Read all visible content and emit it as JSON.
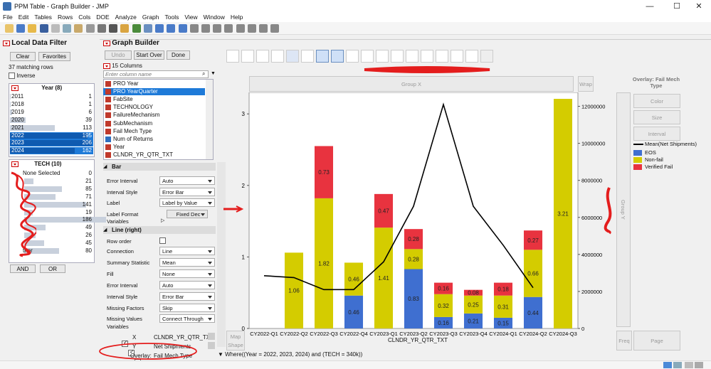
{
  "window": {
    "title": "PPM Table - Graph Builder - JMP",
    "min": "—",
    "max": "☐",
    "close": "✕"
  },
  "menu": [
    "File",
    "Edit",
    "Tables",
    "Rows",
    "Cols",
    "DOE",
    "Analyze",
    "Graph",
    "Tools",
    "View",
    "Window",
    "Help"
  ],
  "filter": {
    "title": "Local Data Filter",
    "clear": "Clear",
    "favorites": "Favorites",
    "matching": "37 matching rows",
    "inverse": "Inverse",
    "year_head": "Year (8)",
    "years": [
      {
        "label": "2011",
        "count": "1",
        "frac": 0.005,
        "sel": false
      },
      {
        "label": "2018",
        "count": "1",
        "frac": 0.005,
        "sel": false
      },
      {
        "label": "2019",
        "count": "6",
        "frac": 0.03,
        "sel": false
      },
      {
        "label": "2020",
        "count": "39",
        "frac": 0.19,
        "sel": false
      },
      {
        "label": "2021",
        "count": "113",
        "frac": 0.55,
        "sel": false
      },
      {
        "label": "2022",
        "count": "195",
        "frac": 0.95,
        "sel": true
      },
      {
        "label": "2023",
        "count": "206",
        "frac": 1.0,
        "sel": true
      },
      {
        "label": "2024",
        "count": "162",
        "frac": 0.79,
        "sel": true
      }
    ],
    "tech_head": "TECH (10)",
    "tech": [
      {
        "label": "None Selected",
        "count": "0",
        "frac": 0
      },
      {
        "label": "",
        "count": "21",
        "frac": 0.11
      },
      {
        "label": "",
        "count": "85",
        "frac": 0.46
      },
      {
        "label": "",
        "count": "71",
        "frac": 0.38
      },
      {
        "label": "",
        "count": "141",
        "frac": 0.76
      },
      {
        "label": "",
        "count": "19",
        "frac": 0.1
      },
      {
        "label": "",
        "count": "186",
        "frac": 1.0
      },
      {
        "label": "",
        "count": "49",
        "frac": 0.26
      },
      {
        "label": "",
        "count": "26",
        "frac": 0.14
      },
      {
        "label": "",
        "count": "45",
        "frac": 0.24
      },
      {
        "label": "ther",
        "count": "80",
        "frac": 0.43
      }
    ],
    "and": "AND",
    "or": "OR"
  },
  "builder": {
    "title": "Graph Builder",
    "undo": "Undo",
    "startover": "Start Over",
    "done": "Done",
    "columns_head": "15 Columns",
    "search_placeholder": "Enter column name",
    "columns": [
      {
        "name": "PRO Year",
        "sel": false
      },
      {
        "name": "PRO YearQuarter",
        "sel": true
      },
      {
        "name": "FabSite",
        "sel": false
      },
      {
        "name": "TECHNOLOGY",
        "sel": false
      },
      {
        "name": "FailureMechanism",
        "sel": false
      },
      {
        "name": "SubMechanism",
        "sel": false
      },
      {
        "name": "Fail Mech Type",
        "sel": false
      },
      {
        "name": "Num of Returns",
        "sel": false
      },
      {
        "name": "Year",
        "sel": false
      },
      {
        "name": "CLNDR_YR_QTR_TXT",
        "sel": false
      }
    ],
    "bar_head": "Bar",
    "bar_props": [
      {
        "label": "Error Interval",
        "value": "Auto"
      },
      {
        "label": "Interval Style",
        "value": "Error Bar"
      },
      {
        "label": "Label",
        "value": "Label by Value"
      },
      {
        "label": "Label Format",
        "value": "Fixed Dec"
      }
    ],
    "variables": "Variables",
    "line_head": "Line (right)",
    "row_order": "Row order",
    "line_props": [
      {
        "label": "Connection",
        "value": "Line"
      },
      {
        "label": "Summary Statistic",
        "value": "Mean"
      },
      {
        "label": "Fill",
        "value": "None"
      },
      {
        "label": "Error Interval",
        "value": "Auto"
      },
      {
        "label": "Interval Style",
        "value": "Error Bar"
      },
      {
        "label": "Missing Factors",
        "value": "Skip"
      },
      {
        "label": "Missing Values",
        "value": "Connect Through"
      }
    ],
    "vars": [
      {
        "role": "X",
        "col": "CLNDR_YR_QTR_TXT"
      },
      {
        "role": "Y",
        "col": "Net Shipments"
      },
      {
        "role": "Overlay:",
        "col": "Fail Mech Type"
      }
    ]
  },
  "graph": {
    "group_x": "Group X",
    "wrap": "Wrap",
    "group_y": "Group Y",
    "overlay": "Overlay: Fail Mech Type",
    "color": "Color",
    "size": "Size",
    "interval": "Interval",
    "map_shape": "Map Shape",
    "freq": "Freq",
    "page": "Page",
    "where": "Where((Year = 2022, 2023, 2024) and (TECH = 340k))",
    "xlabel": "CLNDR_YR_QTR_TXT"
  },
  "legend": [
    {
      "name": "Mean(Net Shipments)",
      "color": "#000000"
    },
    {
      "name": "EOS",
      "color": "#3f6fd0"
    },
    {
      "name": "Non-fail",
      "color": "#d4cc00"
    },
    {
      "name": "Verified Fail",
      "color": "#e8333f"
    }
  ],
  "chart_data": {
    "type": "bar",
    "categories": [
      "CY2022-Q1",
      "CY2022-Q2",
      "CY2022-Q3",
      "CY2022-Q4",
      "CY2023-Q1",
      "CY2023-Q2",
      "CY2023-Q3",
      "CY2023-Q4",
      "CY2024-Q1",
      "CY2024-Q2",
      "CY2024-Q3"
    ],
    "stacked": true,
    "series": [
      {
        "name": "EOS",
        "color": "#3f6fd0",
        "values": [
          0,
          0,
          0,
          0.46,
          0,
          0.83,
          0.16,
          0.21,
          0.15,
          0.44,
          0
        ],
        "labels": [
          "",
          "",
          "",
          "0.46",
          "",
          "0.83",
          "0.16",
          "0.21",
          "0.15",
          "0.44",
          ""
        ]
      },
      {
        "name": "Non-fail",
        "color": "#d4cc00",
        "values": [
          0,
          1.06,
          1.82,
          0.46,
          1.41,
          0.28,
          0.32,
          0.25,
          0.31,
          0.66,
          3.21
        ],
        "labels": [
          "",
          "1.06",
          "1.82",
          "0.46",
          "1.41",
          "0.28",
          "0.32",
          "0.25",
          "0.31",
          "0.66",
          "3.21"
        ]
      },
      {
        "name": "Verified Fail",
        "color": "#e8333f",
        "values": [
          0,
          0,
          0.73,
          0,
          0.47,
          0.28,
          0.16,
          0.08,
          0.18,
          0.27,
          0
        ],
        "labels": [
          "",
          "",
          "0.73",
          "",
          "0.47",
          "0.28",
          "0.16",
          "0.08",
          "0.18",
          "0.27",
          ""
        ]
      }
    ],
    "line": {
      "name": "Mean(Net Shipments)",
      "color": "#000000",
      "values": [
        2850000,
        2750000,
        2100000,
        2100000,
        3600000,
        6600000,
        12100000,
        6600000,
        4500000,
        2200000
      ]
    },
    "ylim": [
      0,
      3.3
    ],
    "yticks": [
      0,
      1,
      2,
      3
    ],
    "y2lim": [
      0,
      12750000
    ],
    "y2ticks": [
      0,
      2000000,
      4000000,
      6000000,
      8000000,
      10000000,
      12000000
    ],
    "y2ticklabels": [
      "0",
      "2000000",
      "4000000",
      "6000000",
      "8000000",
      "10000000",
      "12000000"
    ]
  }
}
